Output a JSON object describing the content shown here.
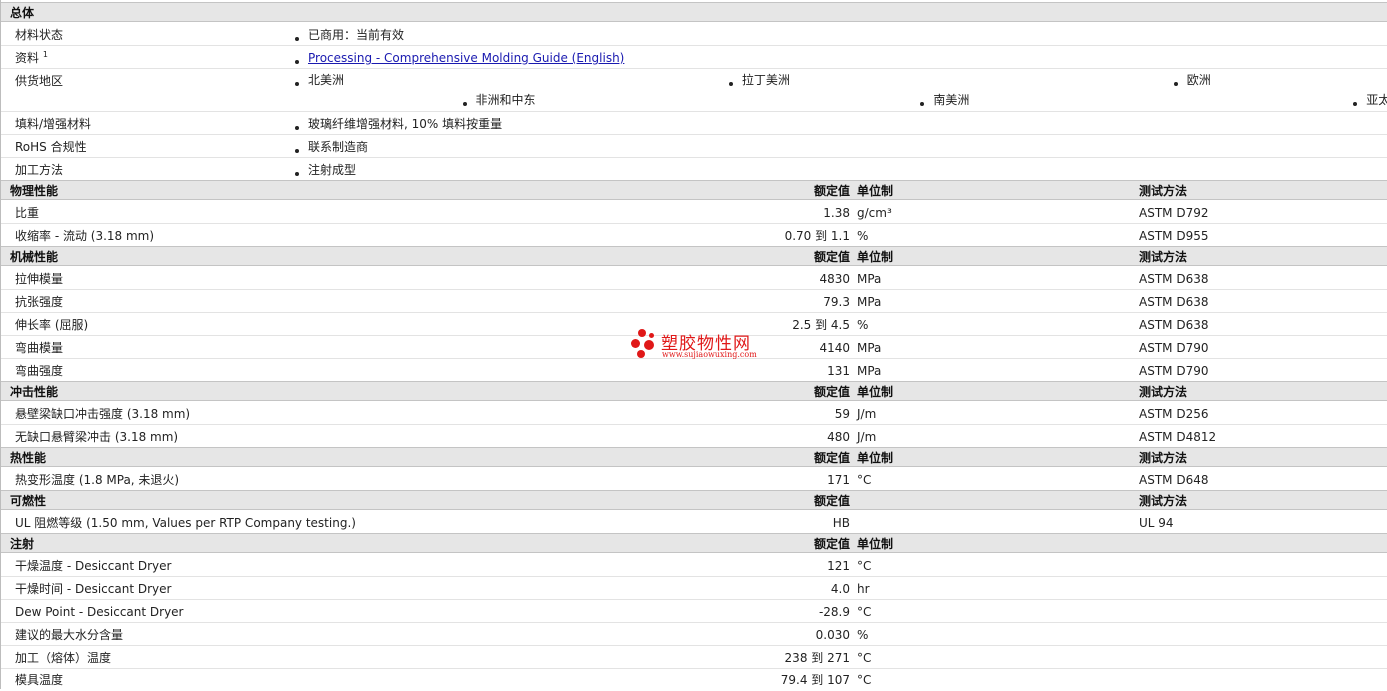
{
  "general": {
    "title": "总体",
    "rows": [
      {
        "label": "材料状态",
        "items": [
          "已商用：当前有效"
        ]
      },
      {
        "label": "资料",
        "sup": "1",
        "items": [
          "Processing - Comprehensive Molding Guide (English)"
        ]
      },
      {
        "label": "供货地区",
        "items": [
          "北美洲",
          "拉丁美洲",
          "欧洲",
          "非洲和中东",
          "南美洲",
          "亚太地区"
        ]
      },
      {
        "label": "填料/增强材料",
        "items": [
          "玻璃纤维增强材料, 10% 填料按重量"
        ]
      },
      {
        "label": "RoHS 合规性",
        "items": [
          "联系制造商"
        ]
      },
      {
        "label": "加工方法",
        "items": [
          "注射成型"
        ]
      }
    ]
  },
  "headers": {
    "value": "额定值",
    "unit": "单位制",
    "test": "测试方法"
  },
  "physical": {
    "title": "物理性能",
    "rows": [
      {
        "label": "比重",
        "value": "1.38",
        "unit": "g/cm³",
        "test": "ASTM D792"
      },
      {
        "label": "收缩率  - 流动  (3.18 mm)",
        "value": "0.70 到  1.1",
        "unit": "%",
        "test": "ASTM D955"
      }
    ]
  },
  "mechanical": {
    "title": "机械性能",
    "rows": [
      {
        "label": "拉伸模量",
        "value": "4830",
        "unit": "MPa",
        "test": "ASTM D638"
      },
      {
        "label": "抗张强度",
        "value": "79.3",
        "unit": "MPa",
        "test": "ASTM D638"
      },
      {
        "label": "伸长率  (屈服)",
        "value": "2.5 到  4.5",
        "unit": "%",
        "test": "ASTM D638"
      },
      {
        "label": "弯曲模量",
        "value": "4140",
        "unit": "MPa",
        "test": "ASTM D790"
      },
      {
        "label": "弯曲强度",
        "value": "131",
        "unit": "MPa",
        "test": "ASTM D790"
      }
    ]
  },
  "impact": {
    "title": "冲击性能",
    "rows": [
      {
        "label": "悬壁梁缺口冲击强度  (3.18 mm)",
        "value": "59",
        "unit": "J/m",
        "test": "ASTM D256"
      },
      {
        "label": "无缺口悬臂梁冲击  (3.18 mm)",
        "value": "480",
        "unit": "J/m",
        "test": "ASTM D4812"
      }
    ]
  },
  "thermal": {
    "title": "热性能",
    "rows": [
      {
        "label": "热变形温度  (1.8 MPa, 未退火)",
        "value": "171",
        "unit": "°C",
        "test": "ASTM D648"
      }
    ]
  },
  "flammability": {
    "title": "可燃性",
    "rows": [
      {
        "label": "UL 阻燃等级  (1.50 mm, Values per RTP Company testing.)",
        "value": "HB",
        "unit": "",
        "test": "UL 94"
      }
    ]
  },
  "injection": {
    "title": "注射",
    "rows": [
      {
        "label": "干燥温度  - Desiccant Dryer",
        "value": "121",
        "unit": "°C"
      },
      {
        "label": "干燥时间  - Desiccant Dryer",
        "value": "4.0",
        "unit": "hr"
      },
      {
        "label": "Dew Point - Desiccant Dryer",
        "value": "-28.9",
        "unit": "°C"
      },
      {
        "label": "建议的最大水分含量",
        "value": "0.030",
        "unit": "%"
      },
      {
        "label": "加工（熔体）温度",
        "value": "238 到  271",
        "unit": "°C"
      },
      {
        "label": "模具温度",
        "value": "79.4 到  107",
        "unit": "°C"
      }
    ]
  },
  "watermark": {
    "name": "塑胶物性网",
    "url": "www.sujiaowuxing.com",
    "color": "#e01818"
  }
}
